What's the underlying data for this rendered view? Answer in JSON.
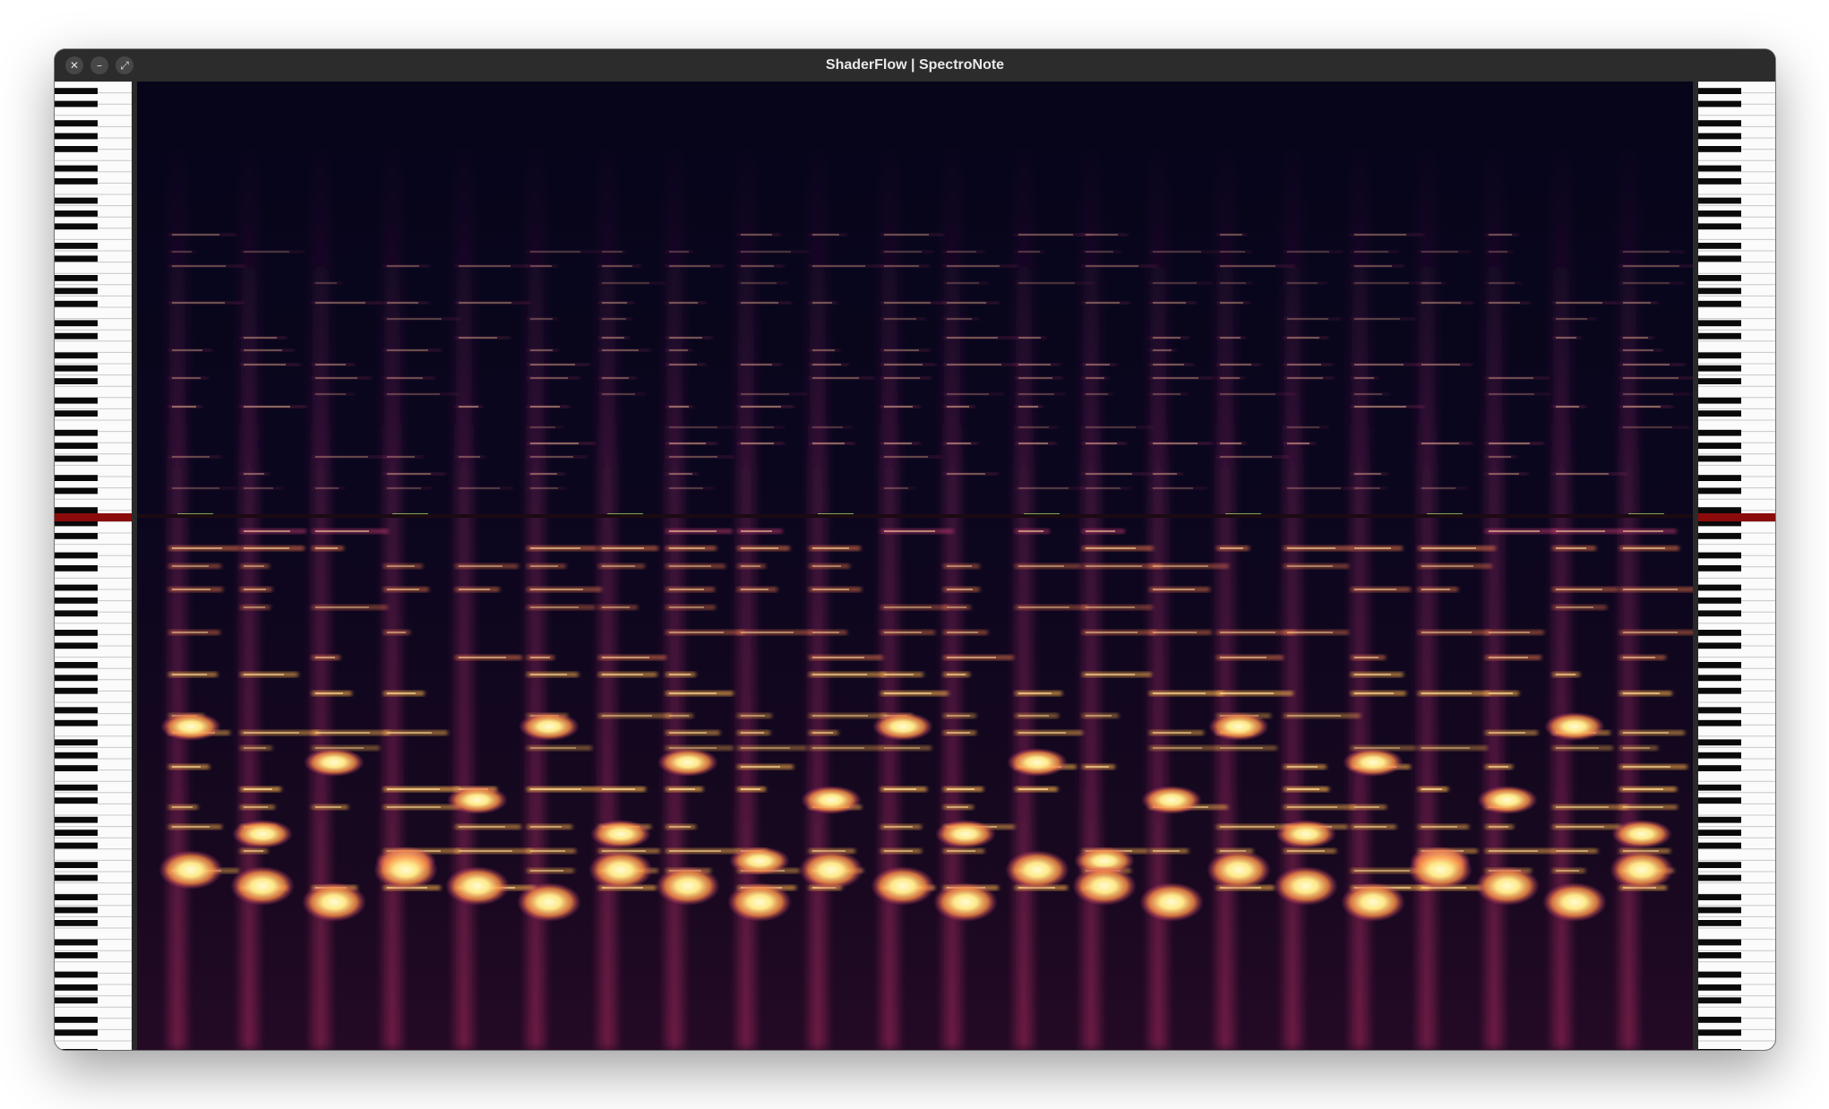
{
  "window": {
    "title": "ShaderFlow | SpectroNote",
    "buttons": [
      {
        "name": "close",
        "glyph": "✕"
      },
      {
        "name": "minimize",
        "glyph": "–"
      },
      {
        "name": "maximize",
        "glyph": "⤢"
      }
    ]
  },
  "piano": {
    "white_key_color": "#fbfbfb",
    "black_key_color": "#0a0a0a",
    "highlight_color": "#8b0b0b"
  },
  "spectrogram": {
    "colormap": "magma",
    "background_color": "#07051a"
  }
}
